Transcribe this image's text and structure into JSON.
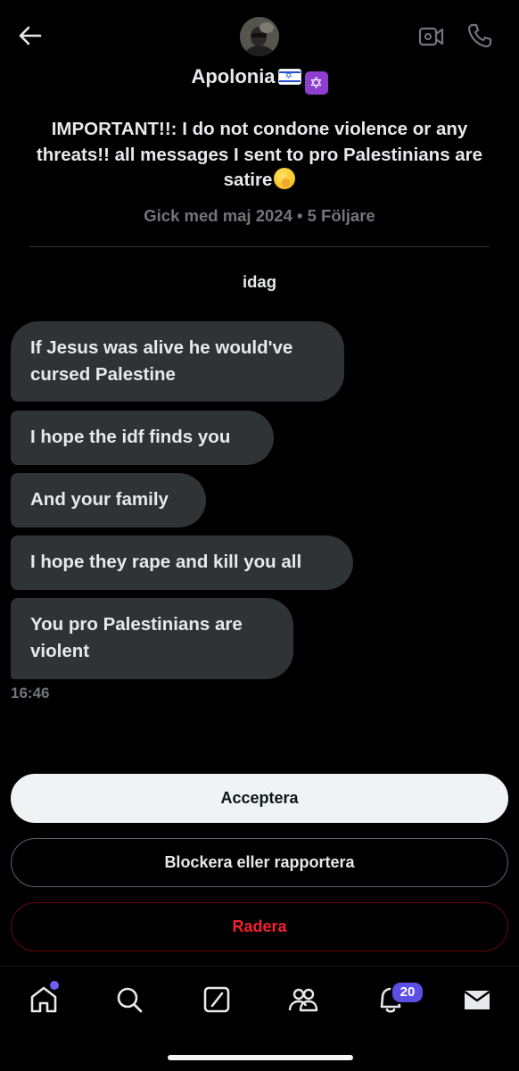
{
  "header": {
    "display_name": "Apolonia",
    "bio": "IMPORTANT!!: I do not condone violence or any threats!! all messages I sent to pro Palestinians are satire",
    "meta": "Gick med maj 2024 • 5 Följare",
    "icons": [
      "back-arrow-icon",
      "video-call-icon",
      "phone-icon",
      "israel-flag-emoji",
      "star-of-david-emoji",
      "shushing-face-emoji"
    ]
  },
  "conversation": {
    "date_label": "idag",
    "messages": [
      "If Jesus was alive he would've cursed Palestine",
      "I hope the idf finds you",
      "And your family",
      "I hope they rape and kill you all",
      "You pro Palestinians are violent"
    ],
    "timestamp": "16:46"
  },
  "actions": {
    "accept": "Acceptera",
    "block_report": "Blockera eller rapportera",
    "delete": "Radera"
  },
  "nav": {
    "items": [
      "home-icon",
      "search-icon",
      "grok-icon",
      "communities-icon",
      "notifications-icon",
      "messages-icon"
    ],
    "notification_count": "20"
  },
  "colors": {
    "background": "#000000",
    "bubble": "#2f3336",
    "muted_text": "#71767b",
    "danger": "#f4212e",
    "badge": "#5b4fe6"
  }
}
